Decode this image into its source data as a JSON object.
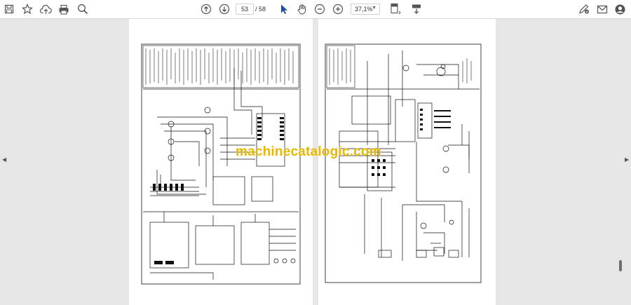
{
  "toolbar": {
    "left_icons": [
      "save-icon",
      "bookmark-star-icon",
      "cloud-upload-icon",
      "print-icon",
      "search-zoom-icon"
    ],
    "nav_icons": [
      "page-up-icon",
      "page-down-icon"
    ],
    "current_page": "53",
    "page_separator": "/",
    "total_pages": "58",
    "tool_icons": [
      "select-cursor-icon",
      "hand-pan-icon",
      "zoom-out-icon",
      "zoom-in-icon"
    ],
    "zoom_level": "37,1%",
    "right_tool_icons": [
      "page-fit-icon",
      "scroll-mode-icon"
    ],
    "far_right_icons": [
      "sign-pen-icon",
      "mail-icon",
      "account-icon"
    ],
    "accent_color": "#1a4f9e"
  },
  "document": {
    "watermark": "machinecatalogic.com"
  }
}
